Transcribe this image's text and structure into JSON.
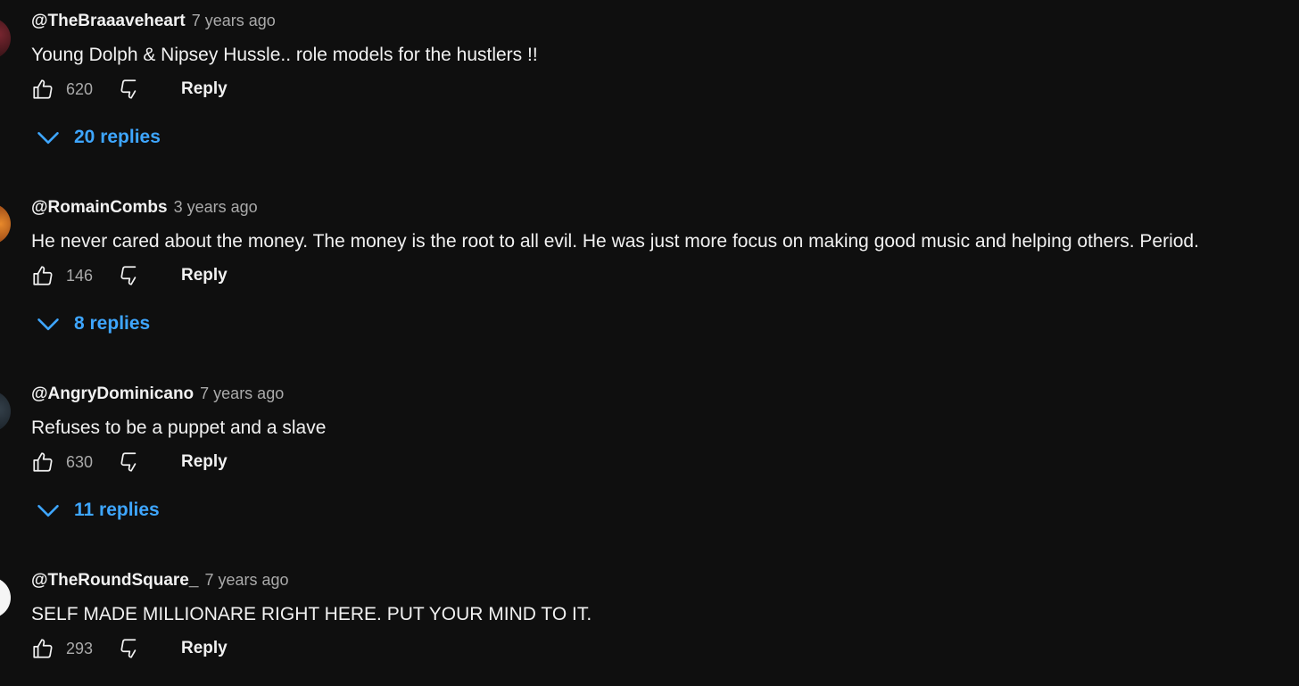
{
  "colors": {
    "background": "#0f0f0f",
    "text": "#f1f1f1",
    "muted": "#aaaaaa",
    "link_blue": "#3ea6ff"
  },
  "icons": {
    "like": "thumbs-up-icon",
    "dislike": "thumbs-down-icon",
    "expand": "chevron-down-icon"
  },
  "comments": [
    {
      "author": "@TheBraaaveheart",
      "time": "7 years ago",
      "text": "Young Dolph & Nipsey Hussle.. role models for the hustlers !!",
      "likes": "620",
      "reply_label": "Reply",
      "replies_label": "20 replies"
    },
    {
      "author": "@RomainCombs",
      "time": "3 years ago",
      "text": "He never cared about the money. The money is the root to all evil. He was just more focus on making good music and helping others. Period.",
      "likes": "146",
      "reply_label": "Reply",
      "replies_label": "8 replies"
    },
    {
      "author": "@AngryDominicano",
      "time": "7 years ago",
      "text": "Refuses to be a puppet and a slave",
      "likes": "630",
      "reply_label": "Reply",
      "replies_label": "11 replies"
    },
    {
      "author": "@TheRoundSquare_",
      "time": "7 years ago",
      "text": "SELF MADE MILLIONARE RIGHT HERE. PUT YOUR MIND TO IT.",
      "likes": "293",
      "reply_label": "Reply"
    }
  ]
}
